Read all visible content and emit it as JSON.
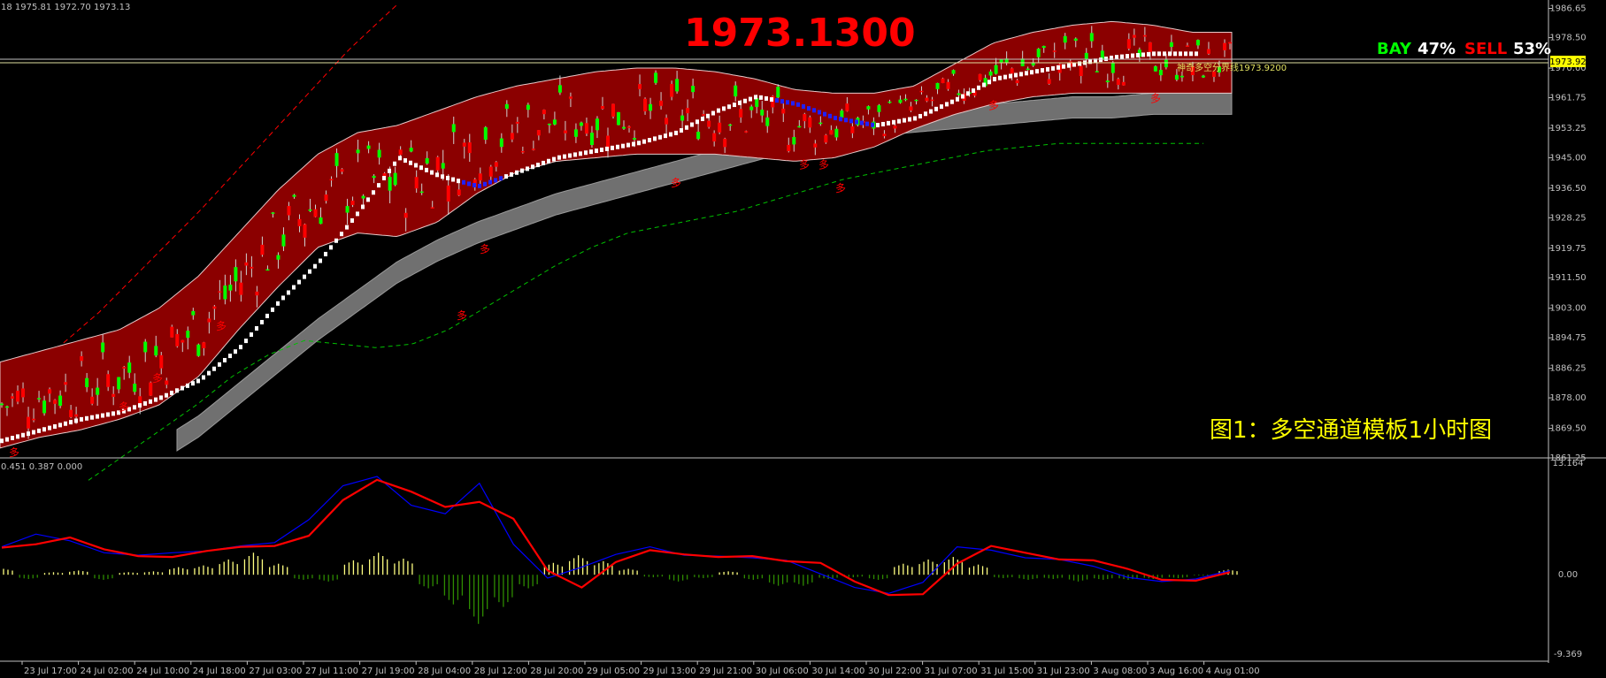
{
  "header": {
    "ohlc_text": "18 1975.81 1972.70 1973.13",
    "big_price": "1973.1300",
    "bay_label": "BAY",
    "bay_pct": "47%",
    "sell_label": "SELL",
    "sell_pct": "53%",
    "caption": "图1：多空通道模板1小时图",
    "line_label": "神奇多空分界线1973.9200",
    "current_price_tag": "1973.92"
  },
  "colors": {
    "background": "#000000",
    "channel_fill": "#8b0000",
    "bull_candle": "#00ff00",
    "bear_candle": "#ff0000",
    "signal_white": "#ffffff",
    "signal_magenta": "#ff00ff",
    "gray_band": "#707070",
    "macd_line": "#ff0000",
    "signal_line": "#0000ff",
    "hist_pos": "#ffff80",
    "hist_neg": "#2e8b00",
    "big_price_color": "#ff0000",
    "caption_color": "#ffff00"
  },
  "price_axis": {
    "ticks": [
      "1986.65",
      "1978.50",
      "1970.00",
      "1961.75",
      "1953.25",
      "1945.00",
      "1936.50",
      "1928.25",
      "1919.75",
      "1911.50",
      "1903.00",
      "1894.75",
      "1886.25",
      "1878.00",
      "1869.50",
      "1861.25"
    ]
  },
  "time_axis": {
    "ticks": [
      "23 Jul 17:00",
      "24 Jul 02:00",
      "24 Jul 10:00",
      "24 Jul 18:00",
      "27 Jul 03:00",
      "27 Jul 11:00",
      "27 Jul 19:00",
      "28 Jul 04:00",
      "28 Jul 12:00",
      "28 Jul 20:00",
      "29 Jul 05:00",
      "29 Jul 13:00",
      "29 Jul 21:00",
      "30 Jul 06:00",
      "30 Jul 14:00",
      "30 Jul 22:00",
      "31 Jul 07:00",
      "31 Jul 15:00",
      "31 Jul 23:00",
      "3 Aug 08:00",
      "3 Aug 16:00",
      "4 Aug 01:00"
    ]
  },
  "indicator": {
    "label": "0.451 0.387 0.000",
    "ticks": [
      "13.164",
      "0.00",
      "-9.369"
    ]
  },
  "markers": {
    "signal_char": "多"
  },
  "chart_data": {
    "type": "candlestick",
    "title": "",
    "ylim": [
      1861.25,
      1989.0
    ],
    "current_price": 1973.92,
    "series": [
      {
        "name": "channel_upper",
        "values": [
          1888,
          1891,
          1894,
          1897,
          1903,
          1912,
          1924,
          1936,
          1946,
          1952,
          1954,
          1958,
          1962,
          1965,
          1967,
          1969,
          1970,
          1970,
          1969,
          1967,
          1964,
          1963,
          1963,
          1965,
          1971,
          1977,
          1980,
          1982,
          1983,
          1982,
          1980,
          1980
        ]
      },
      {
        "name": "channel_lower",
        "values": [
          1864,
          1867,
          1869,
          1872,
          1876,
          1884,
          1897,
          1909,
          1920,
          1924,
          1923,
          1927,
          1935,
          1941,
          1944,
          1945,
          1946,
          1946,
          1946,
          1945,
          1944,
          1945,
          1948,
          1953,
          1957,
          1960,
          1962,
          1963,
          1963,
          1963,
          1963,
          1963
        ]
      },
      {
        "name": "step_line",
        "values": [
          1866,
          1869,
          1872,
          1874,
          1878,
          1883,
          1892,
          1905,
          1916,
          1930,
          1945,
          1940,
          1937,
          1941,
          1945,
          1947,
          1949,
          1952,
          1958,
          1962,
          1960,
          1956,
          1954,
          1956,
          1961,
          1967,
          1969,
          1971,
          1973,
          1974,
          1974,
          1974
        ]
      },
      {
        "name": "gray_band_upper",
        "values": [
          1848,
          1852,
          1856,
          1860,
          1866,
          1873,
          1882,
          1891,
          1900,
          1908,
          1916,
          1922,
          1927,
          1931,
          1935,
          1938,
          1941,
          1944,
          1947,
          1950,
          1953,
          1955,
          1957,
          1958,
          1959,
          1960,
          1961,
          1962,
          1962,
          1963,
          1963,
          1963
        ]
      },
      {
        "name": "dashed_green",
        "values": [
          1855,
          1862,
          1869,
          1876,
          1884,
          1890,
          1894,
          1893,
          1892,
          1893,
          1897,
          1903,
          1909,
          1915,
          1920,
          1924,
          1926,
          1928,
          1930,
          1933,
          1936,
          1939,
          1941,
          1943,
          1945,
          1947,
          1948,
          1949,
          1949,
          1949,
          1949,
          1949
        ]
      },
      {
        "name": "dashed_red",
        "values": [
          1880,
          1890,
          1902,
          1916,
          1930,
          1945,
          1960,
          1975,
          1988
        ]
      }
    ],
    "macd": {
      "ylim": [
        -9.369,
        13.164
      ],
      "macd_line": [
        3.2,
        3.6,
        4.4,
        3.0,
        2.2,
        2.1,
        2.8,
        3.3,
        3.4,
        4.6,
        8.8,
        11.2,
        9.8,
        8.0,
        8.6,
        6.6,
        0.5,
        -1.5,
        1.5,
        2.9,
        2.4,
        2.1,
        2.2,
        1.6,
        1.4,
        -0.8,
        -2.4,
        -2.3,
        1.3,
        3.4,
        2.6,
        1.8,
        1.7,
        0.7,
        -0.6,
        -0.7,
        0.3
      ],
      "signal_line": [
        3.3,
        4.8,
        4.0,
        2.6,
        2.3,
        2.6,
        2.8,
        3.4,
        3.8,
        6.5,
        10.5,
        11.6,
        8.2,
        7.2,
        10.8,
        3.6,
        -0.4,
        0.9,
        2.4,
        3.3,
        2.3,
        2.2,
        2.0,
        1.7,
        0.1,
        -1.5,
        -2.2,
        -0.9,
        3.3,
        2.9,
        2.0,
        1.8,
        1.0,
        -0.3,
        -0.8,
        -0.5,
        0.5
      ],
      "histogram": [
        0.7,
        -0.5,
        0.3,
        0.5,
        -0.6,
        0.3,
        0.4,
        0.9,
        1.1,
        1.8,
        2.6,
        1.3,
        -0.6,
        -0.8,
        1.7,
        2.6,
        1.9,
        -1.6,
        -3.5,
        -5.8,
        -3.8,
        -1.6,
        1.4,
        2.3,
        1.6,
        0.7,
        -0.3,
        -0.8,
        -0.4,
        0.4,
        -0.6,
        -1.3,
        -1.3,
        -0.5,
        -0.3,
        -0.6,
        1.3,
        1.8,
        2.1,
        1.2,
        -0.4,
        -0.6,
        -0.5,
        -0.8,
        -0.6,
        -0.6,
        -0.5,
        -0.4,
        -0.1,
        0.6
      ]
    }
  }
}
